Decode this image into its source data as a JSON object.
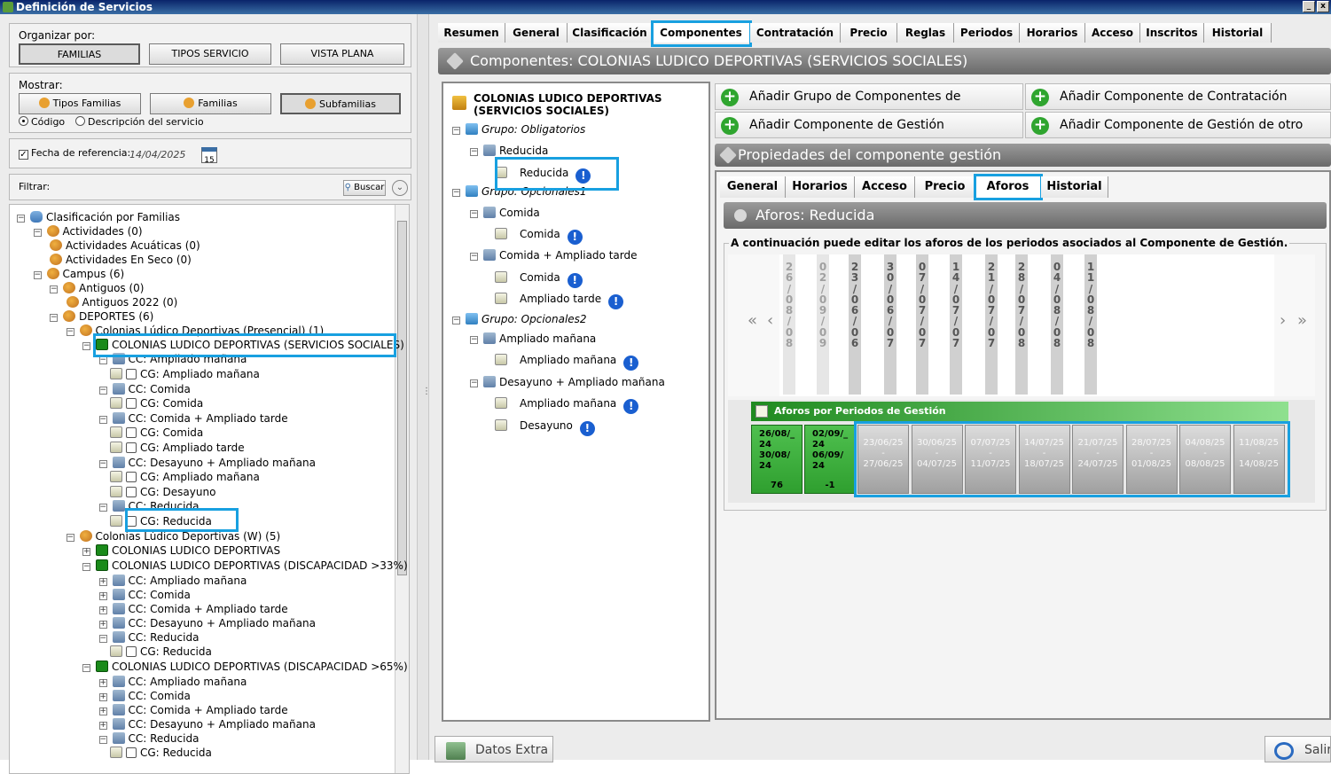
{
  "window": {
    "title": "Definición de Servicios",
    "min": "_",
    "close": "x"
  },
  "left": {
    "organizar_label": "Organizar por:",
    "organizar_buttons": [
      "FAMILIAS",
      "TIPOS SERVICIO",
      "VISTA PLANA"
    ],
    "mostrar_label": "Mostrar:",
    "mostrar_buttons": [
      "Tipos Familias",
      "Familias",
      "Subfamilias"
    ],
    "radio_codigo": "Código",
    "radio_desc": "Descripción del servicio",
    "fecha_label": "Fecha de referencia:",
    "fecha_value": "14/04/2025",
    "calendar_num": "15",
    "filtrar_label": "Filtrar:",
    "buscar": "Buscar",
    "tree": [
      "Clasificación por Familias",
      "Actividades (0)",
      "Actividades Acuáticas (0)",
      "Actividades En Seco (0)",
      "Campus (6)",
      "Antiguos (0)",
      "Antiguos 2022 (0)",
      "DEPORTES (6)",
      "Colonias Lúdico Deportivas (Presencial) (1)",
      "COLONIAS LUDICO DEPORTIVAS (SERVICIOS SOCIALES)",
      "CC: Ampliado mañana",
      "CG: Ampliado mañana",
      "CC: Comida",
      "CG: Comida",
      "CC: Comida + Ampliado tarde",
      "CG: Comida",
      "CG: Ampliado tarde",
      "CC: Desayuno + Ampliado mañana",
      "CG: Ampliado mañana",
      "CG: Desayuno",
      "CC: Reducida",
      "CG: Reducida",
      "Colonias Lúdico Deportivas (W) (5)",
      "COLONIAS LUDICO DEPORTIVAS",
      "COLONIAS LUDICO DEPORTIVAS (DISCAPACIDAD >33%)",
      "CC: Ampliado mañana",
      "CC: Comida",
      "CC: Comida + Ampliado tarde",
      "CC: Desayuno + Ampliado mañana",
      "CC: Reducida",
      "CG: Reducida",
      "COLONIAS LUDICO DEPORTIVAS (DISCAPACIDAD >65%)",
      "CC: Ampliado mañana",
      "CC: Comida",
      "CC: Comida + Ampliado tarde",
      "CC: Desayuno + Ampliado mañana",
      "CC: Reducida",
      "CG: Reducida"
    ]
  },
  "tabs": [
    "Resumen",
    "General",
    "Clasificación",
    "Componentes",
    "Contratación",
    "Precio",
    "Reglas",
    "Periodos",
    "Horarios",
    "Acceso",
    "Inscritos",
    "Historial"
  ],
  "header": "Componentes: COLONIAS LUDICO DEPORTIVAS (SERVICIOS SOCIALES)",
  "comp_tree": [
    "COLONIAS LUDICO DEPORTIVAS",
    "(SERVICIOS SOCIALES)",
    "Grupo: Obligatorios",
    "Reducida",
    "Reducida",
    "Grupo: Opcionales1",
    "Comida",
    "Comida",
    "Comida + Ampliado tarde",
    "Comida",
    "Ampliado tarde",
    "Grupo: Opcionales2",
    "Ampliado mañana",
    "Ampliado mañana",
    "Desayuno + Ampliado mañana",
    "Ampliado mañana",
    "Desayuno"
  ],
  "actions": [
    "Añadir Grupo de Componentes de Contratación",
    "Añadir Componente de Contratación",
    "Añadir Componente de Gestión",
    "Añadir Componente de Gestión de otro servicio"
  ],
  "prop_header": "Propiedades del componente gestión",
  "subtabs": [
    "General",
    "Horarios",
    "Acceso",
    "Precio",
    "Aforos",
    "Historial"
  ],
  "aforos_header": "Aforos: Reducida",
  "fieldset_legend": "A continuación puede editar los aforos de los periodos asociados al Componente de Gestión.",
  "date_columns": [
    "26/08/08",
    "02/09/09",
    "23/06/06",
    "30/06/07",
    "07/07/07",
    "14/07/07",
    "21/07/07",
    "28/07/08",
    "04/08/08",
    "11/08/08"
  ],
  "aforos_title": "Aforos por Periodos de Gestión",
  "aforo_green": [
    {
      "d1": "26/08/_",
      "y1": "24",
      "d2": "30/08/",
      "y2": "24",
      "val": "76"
    },
    {
      "d1": "02/09/_",
      "y1": "24",
      "d2": "06/09/",
      "y2": "24",
      "val": "-1"
    }
  ],
  "aforo_grey": [
    {
      "a": "23/06/25",
      "b": "27/06/25"
    },
    {
      "a": "30/06/25",
      "b": "04/07/25"
    },
    {
      "a": "07/07/25",
      "b": "11/07/25"
    },
    {
      "a": "14/07/25",
      "b": "18/07/25"
    },
    {
      "a": "21/07/25",
      "b": "24/07/25"
    },
    {
      "a": "28/07/25",
      "b": "01/08/25"
    },
    {
      "a": "04/08/25",
      "b": "08/08/25"
    },
    {
      "a": "11/08/25",
      "b": "14/08/25"
    }
  ],
  "dash": "-",
  "nav": {
    "first": "«",
    "prev": "‹",
    "next": "›",
    "last": "»"
  },
  "bottom": {
    "extra": "Datos Extra",
    "salir": "Salir"
  },
  "colors": {
    "highlight": "#18a0e0",
    "green": "#2f9f2f",
    "accent": "#0a246a"
  }
}
